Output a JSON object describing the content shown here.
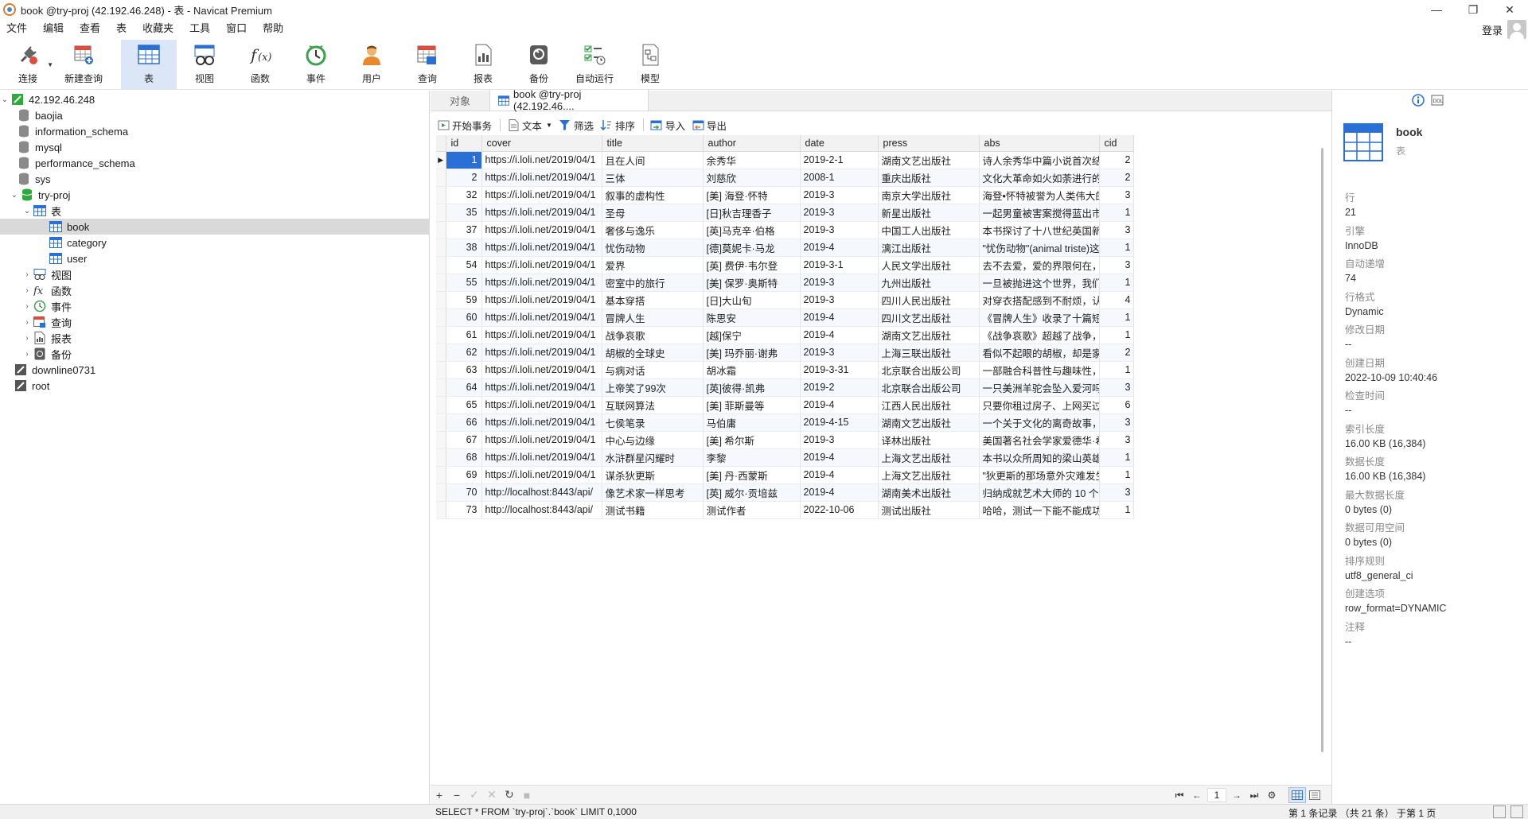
{
  "window": {
    "title": "book @try-proj (42.192.46.248) - 表 - Navicat Premium",
    "controls": [
      "—",
      "❐",
      "✕"
    ]
  },
  "menu": [
    "文件",
    "编辑",
    "查看",
    "表",
    "收藏夹",
    "工具",
    "窗口",
    "帮助"
  ],
  "login": {
    "label": "登录"
  },
  "toolbar": [
    {
      "label": "连接",
      "icon": "plug-icon",
      "dropdown": true
    },
    {
      "label": "新建查询",
      "icon": "new-query-icon"
    },
    {
      "label": "表",
      "icon": "table-icon",
      "active": true
    },
    {
      "label": "视图",
      "icon": "view-glasses-icon"
    },
    {
      "label": "函数",
      "icon": "function-icon"
    },
    {
      "label": "事件",
      "icon": "clock-icon"
    },
    {
      "label": "用户",
      "icon": "user-icon"
    },
    {
      "label": "查询",
      "icon": "query-icon"
    },
    {
      "label": "报表",
      "icon": "report-icon"
    },
    {
      "label": "备份",
      "icon": "backup-icon"
    },
    {
      "label": "自动运行",
      "icon": "checklist-icon"
    },
    {
      "label": "模型",
      "icon": "model-icon"
    }
  ],
  "nav": {
    "connection": "42.192.46.248",
    "databases": [
      "baojia",
      "information_schema",
      "mysql",
      "performance_schema",
      "sys"
    ],
    "active_db": "try-proj",
    "tables_folder": "表",
    "tables": [
      "book",
      "category",
      "user"
    ],
    "folders": [
      "视图",
      "函数",
      "事件",
      "查询",
      "报表",
      "备份"
    ],
    "other_connections": [
      "downline0731",
      "root"
    ]
  },
  "tabs": {
    "objects": "对象",
    "active": "book @try-proj (42.192.46...."
  },
  "gridtools": {
    "begin_tx": "开始事务",
    "text": "文本",
    "filter": "筛选",
    "sort": "排序",
    "import": "导入",
    "export": "导出"
  },
  "columns": [
    "id",
    "cover",
    "title",
    "author",
    "date",
    "press",
    "abs",
    "cid"
  ],
  "rows": [
    [
      "1",
      "https://i.loli.net/2019/04/1",
      "且在人间",
      "余秀华",
      "2019-2-1",
      "湖南文艺出版社",
      "诗人余秀华中篇小说首次结集",
      "2"
    ],
    [
      "2",
      "https://i.loli.net/2019/04/1",
      "三体",
      "刘慈欣",
      " 2008-1",
      "重庆出版社",
      "文化大革命如火如荼进行的同",
      "2"
    ],
    [
      "32",
      "https://i.loli.net/2019/04/1",
      "叙事的虚构性",
      "[美] 海登·怀特",
      "2019-3",
      "南京大学出版社",
      "海登•怀特被誉为人类伟大的",
      "3"
    ],
    [
      "35",
      "https://i.loli.net/2019/04/1",
      "圣母",
      "[日]秋吉理香子",
      "2019-3",
      "新星出版社",
      "一起男童被害案搅得蓝出市人",
      "1"
    ],
    [
      "37",
      "https://i.loli.net/2019/04/1",
      "奢侈与逸乐",
      "[英]马克辛·伯格",
      "2019-3",
      "中国工人出版社",
      "本书探讨了十八世纪英国新兴",
      "3"
    ],
    [
      "38",
      "https://i.loli.net/2019/04/1",
      "忧伤动物",
      "[德]莫妮卡·马龙",
      "2019-4",
      "漓江出版社",
      "\"忧伤动物\"(animal triste)这",
      "1"
    ],
    [
      "54",
      "https://i.loli.net/2019/04/1",
      "爱界",
      "[英] 费伊·韦尔登",
      "2019-3-1",
      "人民文学出版社",
      "去不去爱，爱的界限何在，一",
      "3"
    ],
    [
      "55",
      "https://i.loli.net/2019/04/1",
      "密室中的旅行",
      "[美] 保罗·奥斯特",
      "2019-3",
      "九州出版社",
      "一旦被抛进这个世界，我们就",
      "1"
    ],
    [
      "59",
      "https://i.loli.net/2019/04/1",
      "基本穿搭",
      "[日]大山旬",
      "2019-3",
      "四川人民出版社",
      "对穿衣搭配感到不耐烦，认为",
      "4"
    ],
    [
      "60",
      "https://i.loli.net/2019/04/1",
      "冒牌人生",
      "陈思安",
      "2019-4",
      "四川文艺出版社",
      "《冒牌人生》收录了十篇短篇",
      "1"
    ],
    [
      "61",
      "https://i.loli.net/2019/04/1",
      "战争哀歌",
      "[越]保宁",
      "2019-4",
      "湖南文艺出版社",
      "《战争哀歌》超越了战争，在",
      "1"
    ],
    [
      "62",
      "https://i.loli.net/2019/04/1",
      "胡椒的全球史",
      "[美] 玛乔丽·谢弗",
      "2019-3",
      "上海三联出版社",
      "看似不起眼的胡椒，却是家家",
      "2"
    ],
    [
      "63",
      "https://i.loli.net/2019/04/1",
      "与病对话",
      "胡冰霜",
      "2019-3-31",
      "北京联合出版公司",
      "一部融合科普性与趣味性，着",
      "1"
    ],
    [
      "64",
      "https://i.loli.net/2019/04/1",
      "上帝笑了99次",
      "[英]彼得·凯弗",
      "2019-2",
      "北京联合出版公司",
      "一只美洲羊驼会坠入爱河吗？",
      "3"
    ],
    [
      "65",
      "https://i.loli.net/2019/04/1",
      "互联网算法",
      "[美] 菲斯曼等",
      "2019-4",
      "江西人民出版社",
      "只要你租过房子、上网买过书",
      "6"
    ],
    [
      "66",
      "https://i.loli.net/2019/04/1",
      "七侯笔录",
      "马伯庸",
      "2019-4-15",
      "湖南文艺出版社",
      "一个关于文化的离奇故事，一",
      "3"
    ],
    [
      "67",
      "https://i.loli.net/2019/04/1",
      "中心与边缘",
      "[美] 希尔斯",
      "2019-3",
      "译林出版社",
      "美国著名社会学家爱德华·希",
      "3"
    ],
    [
      "68",
      "https://i.loli.net/2019/04/1",
      "水浒群星闪耀时",
      "李黎",
      "2019-4",
      "上海文艺出版社",
      "本书以众所周知的梁山英雄为",
      "1"
    ],
    [
      "69",
      "https://i.loli.net/2019/04/1",
      "谋杀狄更斯",
      "[美] 丹·西蒙斯",
      "2019-4",
      "上海文艺出版社",
      "\"狄更斯的那场意外灾难发生",
      "1"
    ],
    [
      "70",
      "http://localhost:8443/api/",
      "像艺术家一样思考",
      "[英] 威尔·贡培兹",
      "2019-4",
      "湖南美术出版社",
      "归纳成就艺术大师的 10 个习",
      "3"
    ],
    [
      "73",
      "http://localhost:8443/api/",
      "测试书籍",
      "测试作者",
      "2022-10-06",
      "测试出版社",
      "哈哈，测试一下能不能成功",
      "1"
    ]
  ],
  "info": {
    "name": "book",
    "type": "表",
    "props": [
      {
        "label": "行",
        "value": "21"
      },
      {
        "label": "引擎",
        "value": "InnoDB"
      },
      {
        "label": "自动递增",
        "value": "74"
      },
      {
        "label": "行格式",
        "value": "Dynamic"
      },
      {
        "label": "修改日期",
        "value": "--"
      },
      {
        "label": "创建日期",
        "value": "2022-10-09 10:40:46"
      },
      {
        "label": "检查时间",
        "value": "--"
      },
      {
        "label": "索引长度",
        "value": "16.00 KB (16,384)"
      },
      {
        "label": "数据长度",
        "value": "16.00 KB (16,384)"
      },
      {
        "label": "最大数据长度",
        "value": "0 bytes (0)"
      },
      {
        "label": "数据可用空间",
        "value": "0 bytes (0)"
      },
      {
        "label": "排序规则",
        "value": "utf8_general_ci"
      },
      {
        "label": "创建选项",
        "value": "row_format=DYNAMIC"
      },
      {
        "label": "注释",
        "value": "--"
      }
    ]
  },
  "pager": {
    "page": "1"
  },
  "status": {
    "sql": "SELECT * FROM `try-proj`.`book` LIMIT 0,1000",
    "records": "第 1 条记录 （共 21 条） 于第 1 页"
  },
  "colors": {
    "accent": "#2a6fd6",
    "active_tool_bg": "#dbe7f6",
    "db_green": "#2eaa3c"
  }
}
